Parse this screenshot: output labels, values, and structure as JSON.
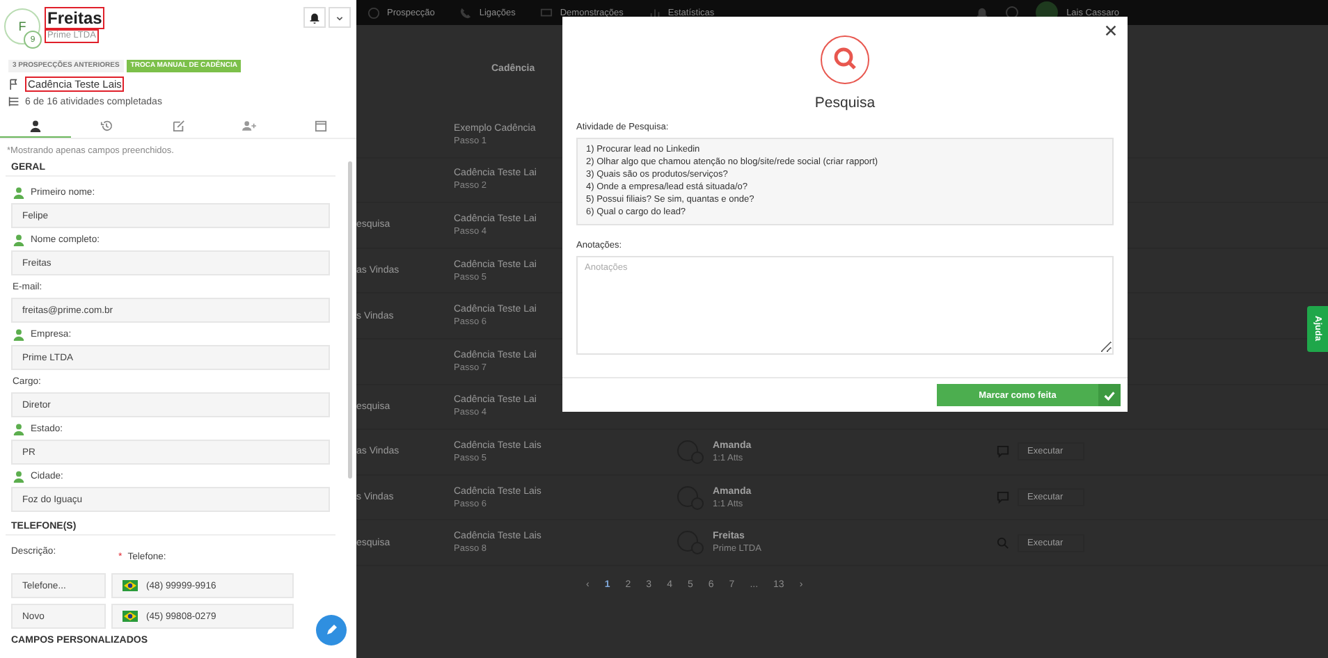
{
  "top_nav": {
    "items": [
      {
        "label": "Prospecção"
      },
      {
        "label": "Ligações"
      },
      {
        "label": "Demonstrações"
      },
      {
        "label": "Estatísticas"
      }
    ],
    "user": "Lais Cassaro"
  },
  "table": {
    "header": "Cadência",
    "rows": [
      {
        "name": "",
        "cadence": "Exemplo Cadência",
        "step": "Passo 1"
      },
      {
        "name": "",
        "cadence": "Cadência Teste Lai",
        "step": "Passo 2"
      },
      {
        "name": "esquisa",
        "cadence": "Cadência Teste Lai",
        "step": "Passo 4"
      },
      {
        "name": "as Vindas",
        "cadence": "Cadência Teste Lai",
        "step": "Passo 5"
      },
      {
        "name": "s Vindas",
        "cadence": "Cadência Teste Lai",
        "step": "Passo 6"
      },
      {
        "name": "",
        "cadence": "Cadência Teste Lai",
        "step": "Passo 7"
      },
      {
        "name": "esquisa",
        "cadence": "Cadência Teste Lai",
        "step": "Passo 4"
      },
      {
        "name": "as Vindas",
        "cadence": "Cadência Teste Lais",
        "step": "Passo 5",
        "lead": "Amanda",
        "lead_detail": "1:1 Atts",
        "action": "Executar",
        "kind": "chat"
      },
      {
        "name": "s Vindas",
        "cadence": "Cadência Teste Lais",
        "step": "Passo 6",
        "lead": "Amanda",
        "lead_detail": "1:1 Atts",
        "action": "Executar",
        "kind": "chat"
      },
      {
        "name": "esquisa",
        "cadence": "Cadência Teste Lais",
        "step": "Passo 8",
        "lead": "Freitas",
        "lead_detail": "Prime LTDA",
        "action": "Executar",
        "kind": "search"
      }
    ]
  },
  "pagination": {
    "prev": "‹",
    "next": "›",
    "pages": [
      {
        "label": "1",
        "selected": true
      },
      {
        "label": "2",
        "selected": false
      },
      {
        "label": "3",
        "selected": false
      },
      {
        "label": "4",
        "selected": false
      },
      {
        "label": "5",
        "selected": false
      },
      {
        "label": "6",
        "selected": false
      },
      {
        "label": "7",
        "selected": false
      },
      {
        "label": "...",
        "selected": false
      },
      {
        "label": "13",
        "selected": false
      }
    ]
  },
  "lead": {
    "initial": "F",
    "badge": "9",
    "name": {
      "text": "Freitas",
      "highlighted": true
    },
    "company": {
      "text": "Prime LTDA",
      "highlighted": true
    },
    "tags": [
      {
        "label": "3 PROSPECÇÕES ANTERIORES",
        "kind": "muted"
      },
      {
        "label": "TROCA MANUAL DE CADÊNCIA",
        "kind": "accent"
      }
    ],
    "cadence": {
      "text": "Cadência Teste Lais",
      "highlighted": true
    },
    "progress": "6 de 16 atividades completadas"
  },
  "tabs": [
    {
      "selected": true
    },
    {
      "selected": false
    },
    {
      "selected": false
    },
    {
      "selected": false
    },
    {
      "selected": false
    }
  ],
  "note": "*Mostrando apenas campos preenchidos.",
  "general": {
    "title": "GERAL",
    "fields": [
      {
        "label": "Primeiro nome:",
        "value": "Felipe",
        "linked": true
      },
      {
        "label": "Nome completo:",
        "value": "Freitas",
        "linked": true
      },
      {
        "label": "E-mail:",
        "value": "freitas@prime.com.br",
        "linked": false
      },
      {
        "label": "Empresa:",
        "value": "Prime LTDA",
        "linked": true
      },
      {
        "label": "Cargo:",
        "value": "Diretor",
        "linked": false
      },
      {
        "label": "Estado:",
        "value": "PR",
        "linked": true
      },
      {
        "label": "Cidade:",
        "value": "Foz do Iguaçu",
        "linked": true
      }
    ]
  },
  "phones": {
    "title": "TELEFONE(S)",
    "description_label": "Descrição:",
    "required_mark": "*",
    "phone_label": "Telefone:",
    "rows": [
      {
        "description": "Telefone...",
        "number": "(48) 99999-9916"
      },
      {
        "description": "Novo",
        "number": "(45) 99808-0279"
      }
    ]
  },
  "custom_title": "CAMPOS PERSONALIZADOS",
  "modal": {
    "title": "Pesquisa",
    "activity_label": "Atividade de Pesquisa:",
    "activity_lines": [
      "1) Procurar lead no Linkedin",
      "2) Olhar algo que chamou atenção no blog/site/rede social (criar rapport)",
      "3) Quais são os produtos/serviços?",
      "4) Onde a empresa/lead está situada/o?",
      "5) Possui filiais? Se sim, quantas e onde?",
      "6) Qual o cargo do lead?"
    ],
    "notes_label": "Anotações:",
    "notes_placeholder": "Anotações",
    "submit": "Marcar como feita"
  },
  "help_tab": "Ajuda"
}
